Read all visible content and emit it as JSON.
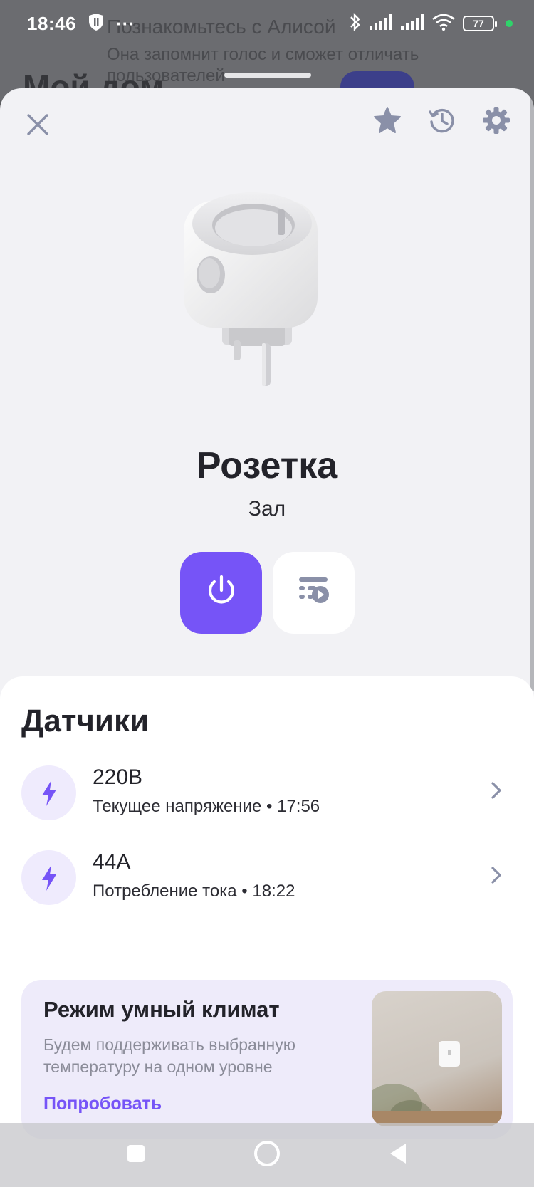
{
  "status_bar": {
    "time": "18:46",
    "battery": "77",
    "dots": "···"
  },
  "background_app": {
    "title": "Мой дом",
    "notification_title": "Познакомьтесь с Алисой",
    "notification_text": "Она запомнит голос и сможет отличать пользователей"
  },
  "device": {
    "name": "Розетка",
    "room": "Зал"
  },
  "sensors": {
    "title": "Датчики",
    "items": [
      {
        "value": "220В",
        "description": "Текущее напряжение • 17:56",
        "icon": "lightning-icon"
      },
      {
        "value": "44А",
        "description": "Потребление тока • 18:22",
        "icon": "lightning-icon"
      }
    ]
  },
  "promo": {
    "title": "Режим умный климат",
    "text": "Будем поддерживать выбранную температуру на одном уровне",
    "link": "Попробовать"
  },
  "icons": {
    "close": "close-icon",
    "favorite": "star-icon",
    "history": "history-icon",
    "settings": "gear-icon",
    "power": "power-icon",
    "scenario": "scenario-icon"
  },
  "colors": {
    "accent": "#7654f7",
    "sheet_bg": "#f2f2f5",
    "icon_gray": "#8a90a8",
    "sensor_icon_bg": "#efebfd",
    "promo_bg": "#eeebfa"
  }
}
